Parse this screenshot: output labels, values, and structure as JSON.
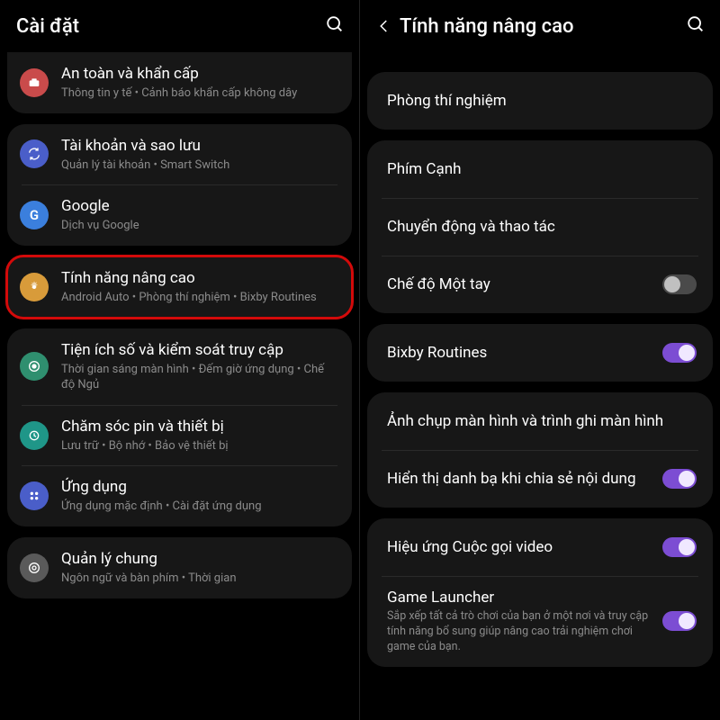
{
  "left": {
    "title": "Cài đặt",
    "items": [
      {
        "icon": "safety",
        "label": "An toàn và khẩn cấp",
        "sub": "Thông tin y tế  •  Cảnh báo khẩn cấp không dây"
      },
      {
        "icon": "sync",
        "label": "Tài khoản và sao lưu",
        "sub": "Quản lý tài khoản  •  Smart Switch"
      },
      {
        "icon": "google",
        "label": "Google",
        "sub": "Dịch vụ Google"
      },
      {
        "icon": "advanced",
        "label": "Tính năng nâng cao",
        "sub": "Android Auto  •  Phòng thí nghiệm  •  Bixby Routines"
      },
      {
        "icon": "wellbeing",
        "label": "Tiện ích số và kiểm soát truy cập",
        "sub": "Thời gian sáng màn hình  •  Đếm giờ ứng dụng  •  Chế độ Ngủ"
      },
      {
        "icon": "battery",
        "label": "Chăm sóc pin và thiết bị",
        "sub": "Lưu trữ  •  Bộ nhớ  •  Bảo vệ thiết bị"
      },
      {
        "icon": "apps",
        "label": "Ứng dụng",
        "sub": "Ứng dụng mặc định  •  Cài đặt ứng dụng"
      },
      {
        "icon": "general",
        "label": "Quản lý chung",
        "sub": "Ngôn ngữ và bàn phím  •  Thời gian"
      }
    ]
  },
  "right": {
    "title": "Tính năng nâng cao",
    "items": [
      {
        "label": "Phòng thí nghiệm",
        "toggle": null
      },
      {
        "label": "Phím Cạnh",
        "toggle": null
      },
      {
        "label": "Chuyển động và thao tác",
        "toggle": null
      },
      {
        "label": "Chế độ Một tay",
        "toggle": false
      },
      {
        "label": "Bixby Routines",
        "toggle": true
      },
      {
        "label": "Ảnh chụp màn hình và trình ghi màn hình",
        "toggle": null
      },
      {
        "label": "Hiển thị danh bạ khi chia sẻ nội dung",
        "toggle": true
      },
      {
        "label": "Hiệu ứng Cuộc gọi video",
        "toggle": true
      },
      {
        "label": "Game Launcher",
        "sub": "Sắp xếp tất cả trò chơi của bạn ở một nơi và truy cập tính năng bổ sung giúp nâng cao trải nghiệm chơi game của bạn.",
        "toggle": true
      }
    ]
  },
  "highlight_left_index": 3,
  "highlight_right_index": 4,
  "colors": {
    "accent": "#7c4dd3"
  }
}
